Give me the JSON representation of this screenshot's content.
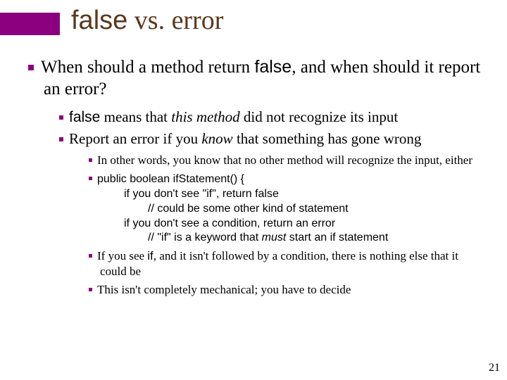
{
  "title": {
    "word_false": "false",
    "rest": " vs. error"
  },
  "l1": {
    "pre": "When should a method return ",
    "code": "false",
    "post": ", and when should it report an error?"
  },
  "l2a": {
    "code": "false",
    "mid": " means that ",
    "em": "this method",
    "post": " did not recognize its input"
  },
  "l2b": {
    "pre": "Report an error if you ",
    "em": "know",
    "post": " that something has gone wrong"
  },
  "l3a": "In other words, you know that no other method will recognize the input, either",
  "code": {
    "line1": "public boolean ifStatement() {",
    "line2": "if you don't see \"if\", return false",
    "line3": "// could be some other kind of statement",
    "line4": "if you don't see a condition, return an error",
    "line5_pre": "// \"if\" is a keyword that ",
    "line5_em": "must",
    "line5_post": " start an if statement"
  },
  "l3c": {
    "pre": "If you see ",
    "code": "if",
    "post": ", and it isn't followed by a condition, there is nothing else that it could be"
  },
  "l3d": "This isn't completely mechanical; you have to decide",
  "page": "21"
}
